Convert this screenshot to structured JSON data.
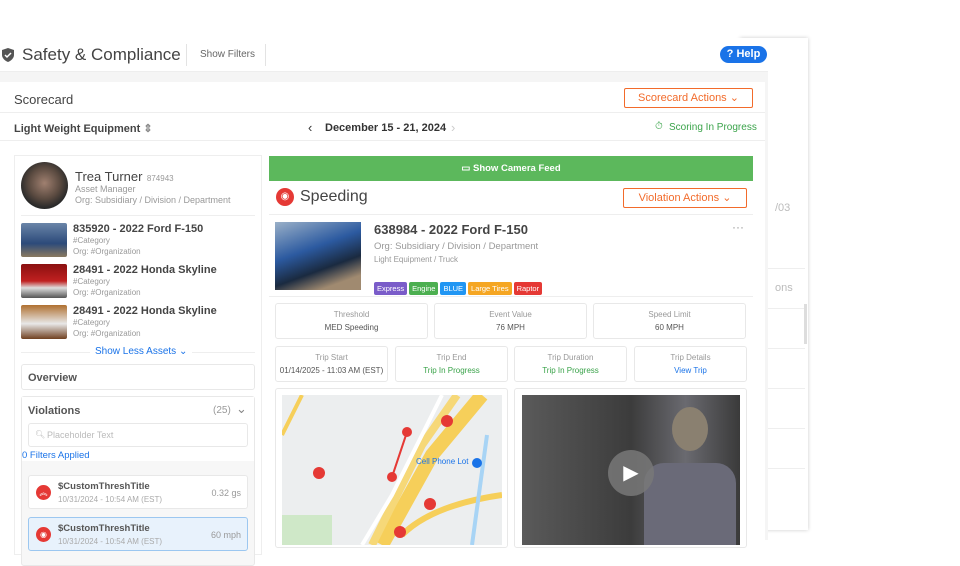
{
  "header": {
    "title": "Safety & Compliance",
    "show_filters": "Show Filters",
    "help": "Help"
  },
  "scorecard": {
    "title": "Scorecard",
    "actions": "Scorecard Actions",
    "equipment": "Light Weight Equipment",
    "date_range": "December 15 - 21, 2024",
    "status": "Scoring In Progress"
  },
  "driver": {
    "name": "Trea Turner",
    "id": "874943",
    "role": "Asset Manager",
    "org": "Org: Subsidiary / Division / Department"
  },
  "assets": [
    {
      "name": "835920 - 2022 Ford F-150",
      "category": "#Category",
      "org": "Org: #Organization"
    },
    {
      "name": "28491 - 2022 Honda Skyline",
      "category": "#Category",
      "org": "Org: #Organization"
    },
    {
      "name": "28491 - 2022 Honda Skyline",
      "category": "#Category",
      "org": "Org: #Organization"
    }
  ],
  "show_less": "Show Less Assets",
  "overview": "Overview",
  "violations": {
    "title": "Violations",
    "count": "(25)",
    "placeholder": "Placeholder Text",
    "filters": "0 Filters Applied",
    "items": [
      {
        "title": "$CustomThreshTitle",
        "date": "10/31/2024 - 10:54 AM (EST)",
        "value": "0.32 gs"
      },
      {
        "title": "$CustomThreshTitle",
        "date": "10/31/2024 - 10:54 AM (EST)",
        "value": "60 mph"
      }
    ]
  },
  "camera_feed": "Show Camera Feed",
  "violation": {
    "type": "Speeding",
    "actions": "Violation Actions",
    "asset": "638984 - 2022 Ford F-150",
    "org": "Org: Subsidiary / Division / Department",
    "category": "Light Equipment / Truck",
    "tags": [
      {
        "label": "Express",
        "color": "#7a5cc9"
      },
      {
        "label": "Engine",
        "color": "#4caf50"
      },
      {
        "label": "BLUE",
        "color": "#2196f3"
      },
      {
        "label": "Large Tires",
        "color": "#f5a623"
      },
      {
        "label": "Raptor",
        "color": "#e53935"
      }
    ],
    "stats": [
      {
        "label": "Threshold",
        "value": "MED Speeding"
      },
      {
        "label": "Event Value",
        "value": "76 MPH"
      },
      {
        "label": "Speed Limit",
        "value": "60 MPH"
      }
    ],
    "trip": [
      {
        "label": "Trip Start",
        "value": "01/14/2025 - 11:03 AM (EST)"
      },
      {
        "label": "Trip End",
        "value": "Trip In Progress"
      },
      {
        "label": "Trip Duration",
        "value": "Trip In Progress"
      },
      {
        "label": "Trip Details",
        "value": "View Trip"
      }
    ],
    "map_label": "Cell Phone Lot"
  },
  "back": {
    "date": "/03",
    "col": "ons"
  },
  "colors": {
    "accent": "#f26b2b",
    "green": "#5cb85c",
    "blue": "#1a73e8",
    "red": "#e53935"
  }
}
